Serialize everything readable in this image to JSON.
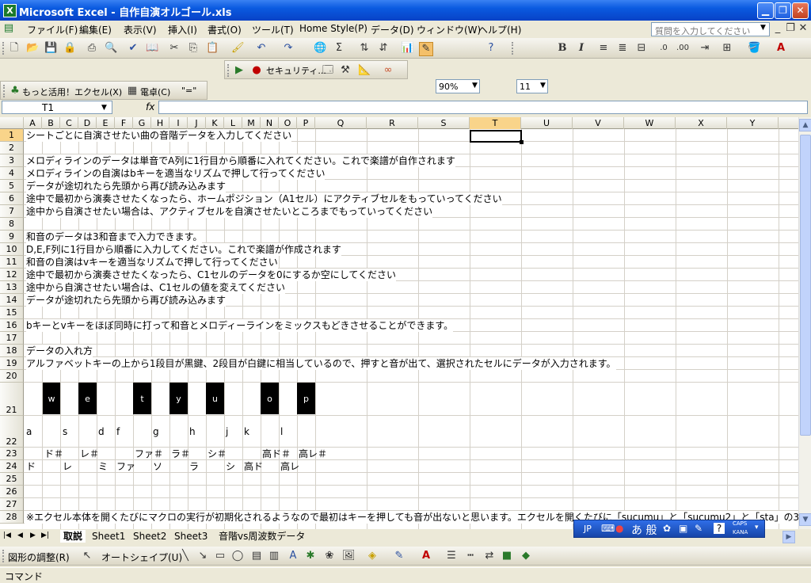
{
  "window": {
    "title": "Microsoft Excel - 自作自演オルゴール.xls"
  },
  "menu": [
    "ファイル(F)",
    "編集(E)",
    "表示(V)",
    "挿入(I)",
    "書式(O)",
    "ツール(T)",
    "Home Style(P)",
    "データ(D)",
    "ウィンドウ(W)",
    "ヘルプ(H)"
  ],
  "help_placeholder": "質問を入力してください",
  "toolbar": {
    "zoom": "90%",
    "font_size": "11",
    "bold": "B",
    "italic": "I"
  },
  "toolbar2": {
    "security": "セキュリティ..."
  },
  "toolbar3": {
    "item1": "もっと活用！エクセル(X)",
    "item2": "電卓(C)",
    "item3": "\"=\""
  },
  "formula": {
    "name_box": "T1",
    "fx": "fx"
  },
  "columns": [
    "A",
    "B",
    "C",
    "D",
    "E",
    "F",
    "G",
    "H",
    "I",
    "J",
    "K",
    "L",
    "M",
    "N",
    "O",
    "P",
    "Q",
    "R",
    "S",
    "T",
    "U",
    "V",
    "W",
    "X",
    "Y"
  ],
  "rows": [
    "1",
    "2",
    "3",
    "4",
    "5",
    "6",
    "7",
    "8",
    "9",
    "10",
    "11",
    "12",
    "13",
    "14",
    "15",
    "16",
    "17",
    "18",
    "19",
    "20",
    "21",
    "22",
    "23",
    "24",
    "25",
    "26",
    "27",
    "28"
  ],
  "cells": {
    "r1": "シートごとに自演させたい曲の音階データを入力してください",
    "r3": "メロディラインのデータは単音でA列に1行目から順番に入れてください。これで楽譜が自作されます",
    "r4": "メロディラインの自演はbキーを適当なリズムで押して行ってください",
    "r5": "データが途切れたら先頭から再び読み込みます",
    "r6": "途中で最初から演奏させたくなったら、ホームポジション（A1セル）にアクティブセルをもっていってください",
    "r7": "途中から自演させたい場合は、アクティブセルを自演させたいところまでもっていってください",
    "r9": "和音のデータは3和音まで入力できます。",
    "r10": "D,E,F列に1行目から順番に入力してください。これで楽譜が作成されます",
    "r11": "和音の自演はvキーを適当なリズムで押して行ってください",
    "r12": "途中で最初から演奏させたくなったら、C1セルのデータを0にするか空にしてください",
    "r13": "途中から自演させたい場合は、C1セルの値を変えてください",
    "r14": "データが途切れたら先頭から再び読み込みます",
    "r16": "bキーとvキーをほぼ同時に打って和音とメロディーラインをミックスもどきさせることができます。",
    "r18": "データの入れ方",
    "r19": "アルファベットキーの上から1段目が黒鍵、2段目が白鍵に相当しているので、押すと音が出て、選択されたセルにデータが入力されます。",
    "r28": "※エクセル本体を開くたびにマクロの実行が初期化されるようなので最初はキーを押しても音が出ないと思います。エクセルを開くたびに「sucumu」と「sucumu2」と「sta」の3つのマク"
  },
  "black_keys": [
    "w",
    "e",
    "t",
    "y",
    "u",
    "o",
    "p"
  ],
  "white_keys": [
    "a",
    "s",
    "d",
    "f",
    "g",
    "h",
    "j",
    "k",
    "l"
  ],
  "sharp_notes": [
    "ド＃",
    "レ＃",
    "ファ＃",
    "ラ＃",
    "シ＃",
    "高ド＃",
    "高レ＃"
  ],
  "natural_notes": [
    "ド",
    "レ",
    "ミ",
    "ファ",
    "ソ",
    "ラ",
    "シ",
    "高ド",
    "高レ"
  ],
  "sheets": [
    "取説",
    "Sheet1",
    "Sheet2",
    "Sheet3",
    "音階vs周波数データ"
  ],
  "ime": {
    "lang": "JP",
    "mode": "あ 般",
    "caps": "CAPS",
    "kana": "KANA"
  },
  "drawing": {
    "adjust": "図形の調整(R)",
    "autoshape": "オートシェイプ(U)"
  },
  "status": "コマンド"
}
